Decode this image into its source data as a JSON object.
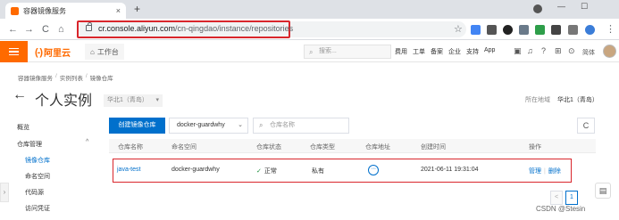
{
  "browser": {
    "tab_title": "容器镜像服务",
    "tab_close": "×",
    "new_tab": "+",
    "minimize": "—",
    "maximize": "☐",
    "url_host": "cr.console.aliyun.com",
    "url_path": "/cn-qingdao/instance/repositories",
    "back": "←",
    "forward": "→",
    "reload": "C",
    "home": "⌂",
    "star": "☆"
  },
  "topbar": {
    "logo_text": "阿里云",
    "logo_mark": "(-)",
    "workbench": "工作台",
    "search_placeholder": "搜索...",
    "nav": [
      "费用",
      "工单",
      "备案",
      "企业",
      "支持",
      "App"
    ],
    "lang": "简体"
  },
  "breadcrumb": [
    "容器镜像服务",
    "实例列表",
    "镜像仓库"
  ],
  "breadcrumb_sep": "/",
  "page": {
    "back_arrow": "←",
    "title": "个人实例",
    "region_select": "华北1（青岛）",
    "region_label": "所在地域",
    "region_value": "华北1（青岛）"
  },
  "sidebar": {
    "items": [
      {
        "label": "概览",
        "level": 0,
        "active": false
      },
      {
        "label": "仓库管理",
        "level": 0,
        "active": false
      },
      {
        "label": "镜像仓库",
        "level": 1,
        "active": true
      },
      {
        "label": "命名空间",
        "level": 1,
        "active": false
      },
      {
        "label": "代码源",
        "level": 1,
        "active": false
      },
      {
        "label": "访问凭证",
        "level": 1,
        "active": false
      }
    ],
    "expand_caret": "^",
    "handle": "›"
  },
  "toolbar": {
    "create_label": "创建镜像仓库",
    "namespace_value": "docker-guardwhy",
    "search_placeholder": "仓库名称",
    "refresh": "C"
  },
  "table": {
    "headers": [
      "仓库名称",
      "命名空间",
      "仓库状态",
      "仓库类型",
      "仓库地址",
      "创建时间",
      "操作"
    ],
    "rows": [
      {
        "name": "java-test",
        "namespace": "docker-guardwhy",
        "status": "正常",
        "type": "私有",
        "address_icon": "···",
        "created": "2021-06-11 19:31:04",
        "op_manage": "管理",
        "op_delete": "删除"
      }
    ]
  },
  "pagination": {
    "prev": "<",
    "current": "1",
    "next": ">"
  },
  "watermark": "CSDN @Stesin",
  "colors": {
    "brand": "#ff6a00",
    "primary": "#0070cc",
    "highlight": "#d9262c",
    "success": "#1e8e3e"
  }
}
